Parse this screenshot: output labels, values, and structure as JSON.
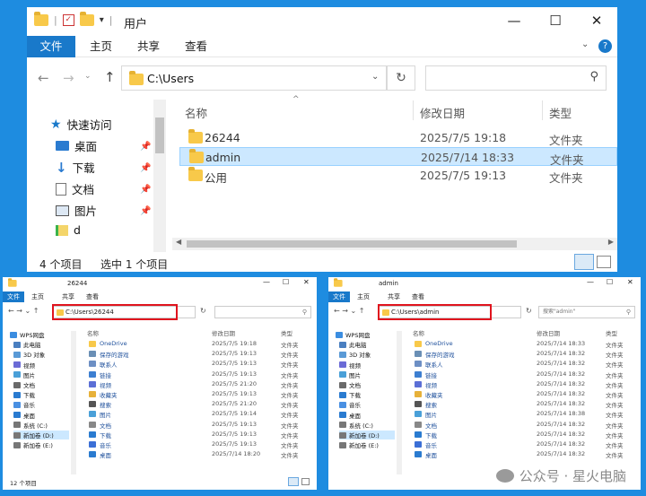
{
  "main": {
    "title": "用户",
    "ribbon_tabs": [
      "文件",
      "主页",
      "共享",
      "查看"
    ],
    "address": "C:\\Users",
    "nav_items": [
      {
        "label": "快速访问",
        "icon": "star-icon"
      },
      {
        "label": "桌面",
        "icon": "desktop-icon"
      },
      {
        "label": "下载",
        "icon": "download-icon"
      },
      {
        "label": "文档",
        "icon": "document-icon"
      },
      {
        "label": "图片",
        "icon": "picture-icon"
      },
      {
        "label": "d",
        "icon": "folder-icon"
      }
    ],
    "columns": {
      "name": "名称",
      "date": "修改日期",
      "type": "类型"
    },
    "rows": [
      {
        "name": "26244",
        "date": "2025/7/5 19:18",
        "type": "文件夹",
        "selected": false
      },
      {
        "name": "admin",
        "date": "2025/7/14 18:33",
        "type": "文件夹",
        "selected": true
      },
      {
        "name": "公用",
        "date": "2025/7/5 19:13",
        "type": "文件夹",
        "selected": false
      }
    ],
    "status_count": "4 个项目",
    "status_selected": "选中 1 个项目"
  },
  "left": {
    "title": "26244",
    "ribbon_tabs": [
      "文件",
      "主页",
      "共享",
      "查看"
    ],
    "address": "C:\\Users\\26244",
    "nav_items": [
      "WPS网盘",
      "此电脑",
      "3D 对象",
      "视频",
      "图片",
      "文档",
      "下载",
      "音乐",
      "桌面",
      "系统 (C:)",
      "新加卷 (D:)",
      "新加卷 (E:)"
    ],
    "columns": {
      "name": "名称",
      "date": "修改日期",
      "type": "类型"
    },
    "rows": [
      {
        "name": "OneDrive",
        "date": "2025/7/5 19:18",
        "type": "文件夹"
      },
      {
        "name": "保存的游戏",
        "date": "2025/7/5 19:13",
        "type": "文件夹"
      },
      {
        "name": "联系人",
        "date": "2025/7/5 19:13",
        "type": "文件夹"
      },
      {
        "name": "链接",
        "date": "2025/7/5 19:13",
        "type": "文件夹"
      },
      {
        "name": "视频",
        "date": "2025/7/5 21:20",
        "type": "文件夹"
      },
      {
        "name": "收藏夹",
        "date": "2025/7/5 19:13",
        "type": "文件夹"
      },
      {
        "name": "搜索",
        "date": "2025/7/5 21:20",
        "type": "文件夹"
      },
      {
        "name": "图片",
        "date": "2025/7/5 19:14",
        "type": "文件夹"
      },
      {
        "name": "文档",
        "date": "2025/7/5 19:13",
        "type": "文件夹"
      },
      {
        "name": "下载",
        "date": "2025/7/5 19:13",
        "type": "文件夹"
      },
      {
        "name": "音乐",
        "date": "2025/7/5 19:13",
        "type": "文件夹"
      },
      {
        "name": "桌面",
        "date": "2025/7/14 18:20",
        "type": "文件夹"
      }
    ],
    "status": "12 个项目"
  },
  "right": {
    "title": "admin",
    "ribbon_tabs": [
      "文件",
      "主页",
      "共享",
      "查看"
    ],
    "address": "C:\\Users\\admin",
    "search_placeholder": "搜索\"admin\"",
    "nav_items": [
      "WPS网盘",
      "此电脑",
      "3D 对象",
      "视频",
      "图片",
      "文档",
      "下载",
      "音乐",
      "桌面",
      "系统 (C:)",
      "新加卷 (D:)",
      "新加卷 (E:)"
    ],
    "columns": {
      "name": "名称",
      "date": "修改日期",
      "type": "类型"
    },
    "rows": [
      {
        "name": "OneDrive",
        "date": "2025/7/14 18:33",
        "type": "文件夹"
      },
      {
        "name": "保存的游戏",
        "date": "2025/7/14 18:32",
        "type": "文件夹"
      },
      {
        "name": "联系人",
        "date": "2025/7/14 18:32",
        "type": "文件夹"
      },
      {
        "name": "链接",
        "date": "2025/7/14 18:32",
        "type": "文件夹"
      },
      {
        "name": "视频",
        "date": "2025/7/14 18:32",
        "type": "文件夹"
      },
      {
        "name": "收藏夹",
        "date": "2025/7/14 18:32",
        "type": "文件夹"
      },
      {
        "name": "搜索",
        "date": "2025/7/14 18:32",
        "type": "文件夹"
      },
      {
        "name": "图片",
        "date": "2025/7/14 18:38",
        "type": "文件夹"
      },
      {
        "name": "文档",
        "date": "2025/7/14 18:32",
        "type": "文件夹"
      },
      {
        "name": "下载",
        "date": "2025/7/14 18:32",
        "type": "文件夹"
      },
      {
        "name": "音乐",
        "date": "2025/7/14 18:32",
        "type": "文件夹"
      },
      {
        "name": "桌面",
        "date": "2025/7/14 18:32",
        "type": "文件夹"
      }
    ]
  },
  "watermark": "公众号 · 星火电脑",
  "colors": {
    "accent": "#1979ca",
    "background": "#1e8ce0",
    "highlight": "#e0141e",
    "selected_row": "#cce8ff"
  }
}
